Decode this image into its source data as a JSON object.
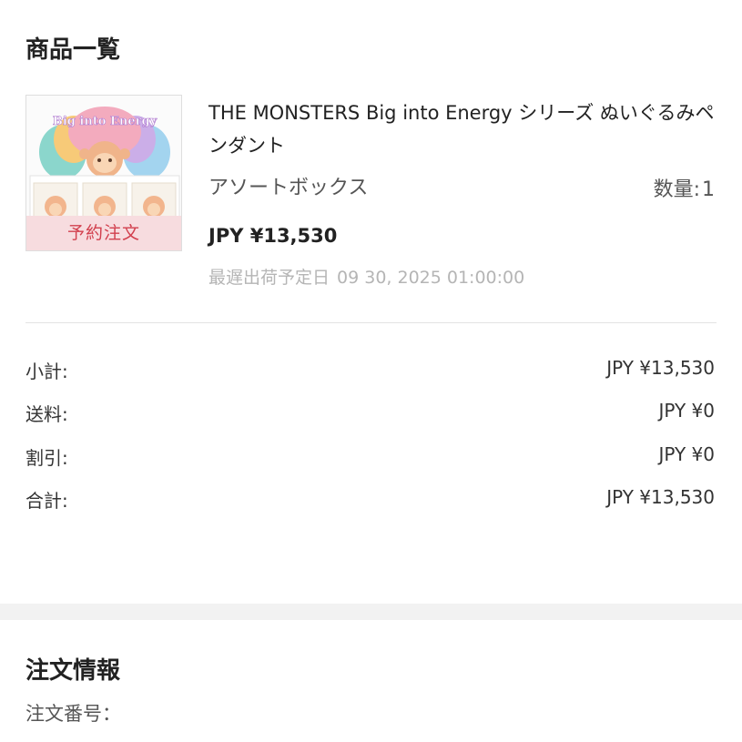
{
  "items_section": {
    "title": "商品一覧",
    "product": {
      "image_alt": "THE MONSTERS Big into Energy box art",
      "image_logo_text": "Big into Energy",
      "badge": "予約注文",
      "name": "THE MONSTERS Big into Energy シリーズ ぬいぐるみペンダント",
      "variant": "アソートボックス",
      "quantity_label": "数量:",
      "quantity": "1",
      "price": "JPY ¥13,530",
      "ship_date_label": "最遅出荷予定日",
      "ship_date": "09 30, 2025 01:00:00"
    }
  },
  "summary": {
    "rows": [
      {
        "label": "小計:",
        "value": "JPY ¥13,530"
      },
      {
        "label": "送料:",
        "value": "JPY ¥0"
      },
      {
        "label": "割引:",
        "value": "JPY ¥0"
      },
      {
        "label": "合計:",
        "value": "JPY ¥13,530"
      }
    ]
  },
  "order_section": {
    "title": "注文情報",
    "order_number_label": "注文番号："
  },
  "colors": {
    "badge_bg": "#f7dcdf",
    "badge_text": "#d2404e",
    "divider": "#e3e3e3",
    "section_band": "#f2f2f2"
  }
}
